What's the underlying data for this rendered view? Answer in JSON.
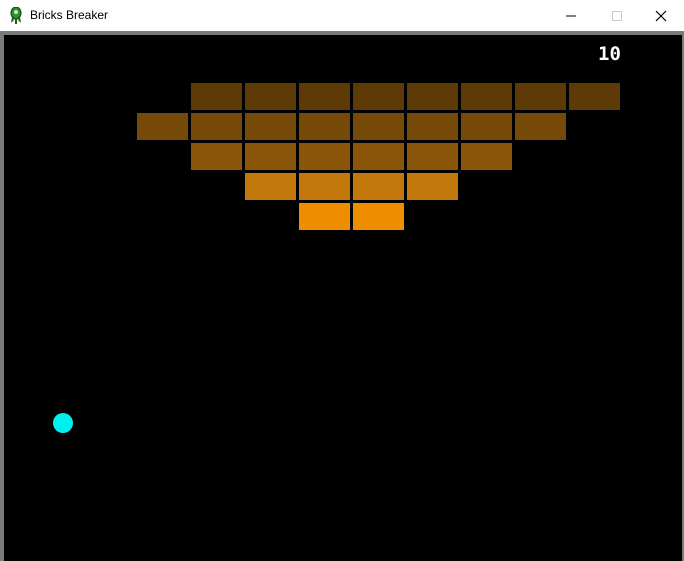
{
  "window": {
    "title": "Bricks Breaker"
  },
  "game": {
    "score": "10",
    "background_color": "#000000",
    "ball_color": "#00f0f0",
    "brick_rows": [
      {
        "color": "#5d3a06",
        "cols": [
          1,
          2,
          3,
          4,
          5,
          6,
          7,
          8
        ]
      },
      {
        "color": "#754908",
        "cols": [
          0,
          1,
          2,
          3,
          4,
          5,
          6,
          7
        ]
      },
      {
        "color": "#8b560a",
        "cols": [
          1,
          2,
          3,
          4,
          5,
          6
        ]
      },
      {
        "color": "#c2780a",
        "cols": [
          2,
          3,
          4,
          5
        ]
      },
      {
        "color": "#ee8d00",
        "cols": [
          3,
          4
        ]
      }
    ]
  },
  "icons": {
    "app": "rocket-icon",
    "minimize": "minimize-icon",
    "maximize": "maximize-icon",
    "close": "close-icon"
  }
}
